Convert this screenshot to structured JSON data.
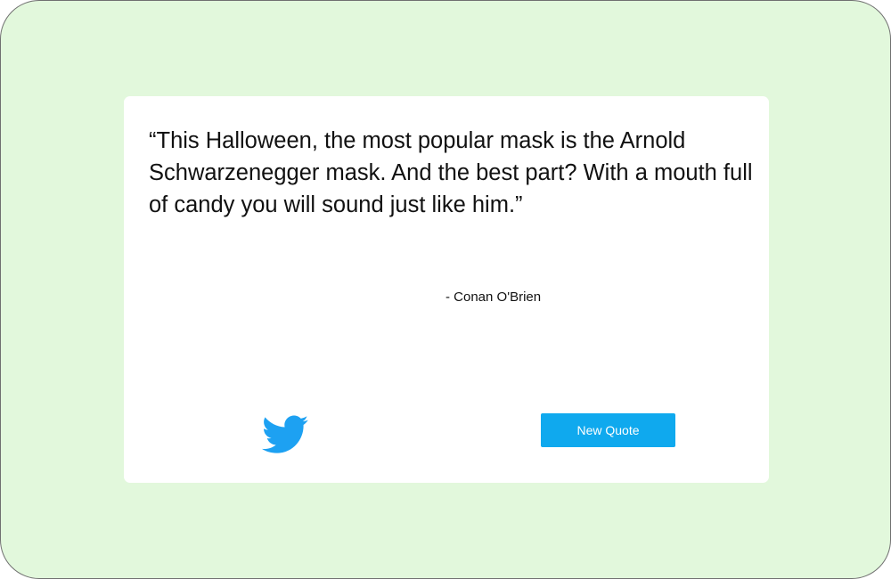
{
  "quote": {
    "text": "“This Halloween, the most popular mask is the Arnold Schwarzenegger mask. And the best part? With a mouth full of candy you will sound just like him.”",
    "author": "- Conan O'Brien"
  },
  "actions": {
    "tweet_icon": "twitter-bird-icon",
    "new_quote_label": "New Quote"
  },
  "colors": {
    "page_background": "#e2f8dc",
    "card_background": "#ffffff",
    "accent": "#0fa9ee",
    "twitter_blue": "#1da1f2"
  }
}
